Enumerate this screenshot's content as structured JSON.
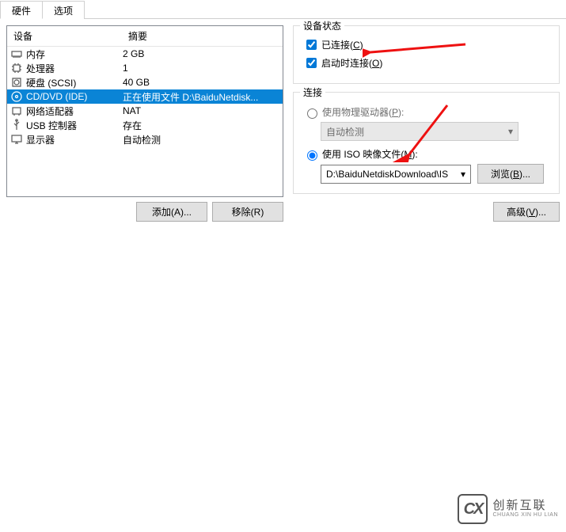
{
  "tabs": {
    "hardware": "硬件",
    "options": "选项"
  },
  "list": {
    "header_device": "设备",
    "header_summary": "摘要",
    "rows": [
      {
        "name": "内存",
        "summary": "2 GB"
      },
      {
        "name": "处理器",
        "summary": "1"
      },
      {
        "name": "硬盘 (SCSI)",
        "summary": "40 GB"
      },
      {
        "name": "CD/DVD (IDE)",
        "summary": "正在使用文件 D:\\BaiduNetdisk..."
      },
      {
        "name": "网络适配器",
        "summary": "NAT"
      },
      {
        "name": "USB 控制器",
        "summary": "存在"
      },
      {
        "name": "显示器",
        "summary": "自动检测"
      }
    ],
    "add_btn": "添加(A)...",
    "remove_btn": "移除(R)"
  },
  "device_status": {
    "title": "设备状态",
    "connected": "已连接(C)",
    "connect_at_poweron": "启动时连接(O)"
  },
  "connection": {
    "title": "连接",
    "use_physical": "使用物理驱动器(P):",
    "auto_detect": "自动检测",
    "use_iso": "使用 ISO 映像文件(M):",
    "iso_path": "D:\\BaiduNetdiskDownload\\IS",
    "browse": "浏览(B)..."
  },
  "advanced": "高级(V)...",
  "logo": {
    "cn": "创新互联",
    "py": "CHUANG XIN HU LIAN"
  }
}
